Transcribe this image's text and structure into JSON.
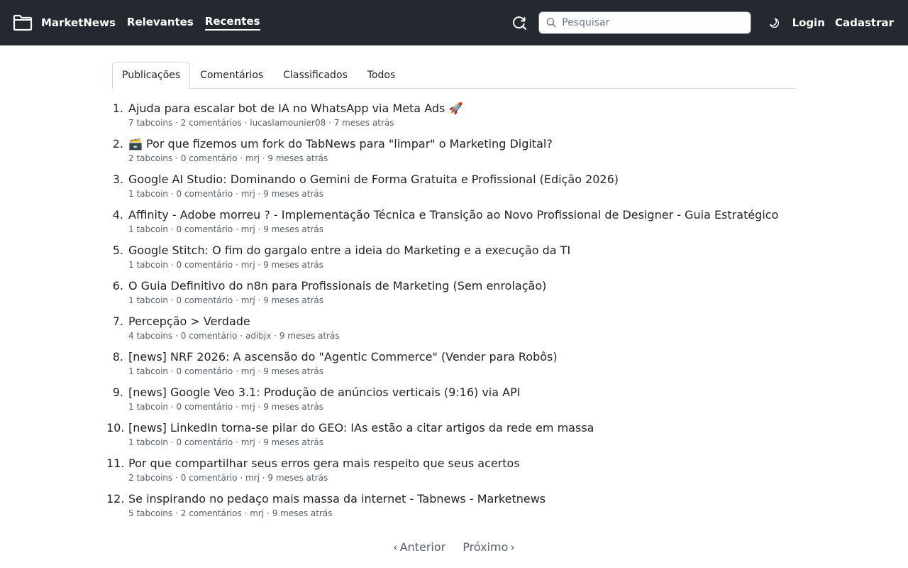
{
  "header": {
    "brand": "MarketNews",
    "nav": [
      {
        "label": "Relevantes"
      },
      {
        "label": "Recentes"
      }
    ],
    "search_placeholder": "Pesquisar",
    "login": "Login",
    "signup": "Cadastrar",
    "icons": [
      "folder-logo-icon",
      "refresh-search-icon",
      "search-icon",
      "moon-icon"
    ]
  },
  "tabs": [
    {
      "label": "Publicações"
    },
    {
      "label": "Comentários"
    },
    {
      "label": "Classificados"
    },
    {
      "label": "Todos"
    }
  ],
  "sep": "·",
  "posts": [
    {
      "n": "1.",
      "title": "Ajuda para escalar bot de IA no WhatsApp via Meta Ads 🚀",
      "tabcoins": "7 tabcoins",
      "comments": "2 comentários",
      "author": "lucaslamounier08",
      "time": "7 meses atrás"
    },
    {
      "n": "2.",
      "title": "🗃️ Por que fizemos um fork do TabNews para \"limpar\" o Marketing Digital?",
      "tabcoins": "2 tabcoins",
      "comments": "0 comentário",
      "author": "mrj",
      "time": "9 meses atrás"
    },
    {
      "n": "3.",
      "title": "Google AI Studio: Dominando o Gemini de Forma Gratuita e Profissional (Edição 2026)",
      "tabcoins": "1 tabcoin",
      "comments": "0 comentário",
      "author": "mrj",
      "time": "9 meses atrás"
    },
    {
      "n": "4.",
      "title": "Affinity - Adobe morreu ? - Implementação Técnica e Transição ao Novo Profissional de Designer - Guia Estratégico",
      "tabcoins": "1 tabcoin",
      "comments": "0 comentário",
      "author": "mrj",
      "time": "9 meses atrás"
    },
    {
      "n": "5.",
      "title": "Google Stitch: O fim do gargalo entre a ideia do Marketing e a execução da TI",
      "tabcoins": "1 tabcoin",
      "comments": "0 comentário",
      "author": "mrj",
      "time": "9 meses atrás"
    },
    {
      "n": "6.",
      "title": "O Guia Definitivo do n8n para Profissionais de Marketing (Sem enrolação)",
      "tabcoins": "1 tabcoin",
      "comments": "0 comentário",
      "author": "mrj",
      "time": "9 meses atrás"
    },
    {
      "n": "7.",
      "title": "Percepção > Verdade",
      "tabcoins": "4 tabcoins",
      "comments": "0 comentário",
      "author": "adibjx",
      "time": "9 meses atrás"
    },
    {
      "n": "8.",
      "title": "[news] NRF 2026: A ascensão do \"Agentic Commerce\" (Vender para Robôs)",
      "tabcoins": "1 tabcoin",
      "comments": "0 comentário",
      "author": "mrj",
      "time": "9 meses atrás"
    },
    {
      "n": "9.",
      "title": "[news] Google Veo 3.1: Produção de anúncios verticais (9:16) via API",
      "tabcoins": "1 tabcoin",
      "comments": "0 comentário",
      "author": "mrj",
      "time": "9 meses atrás"
    },
    {
      "n": "10.",
      "title": "[news] LinkedIn torna-se pilar do GEO: IAs estão a citar artigos da rede em massa",
      "tabcoins": "1 tabcoin",
      "comments": "0 comentário",
      "author": "mrj",
      "time": "9 meses atrás"
    },
    {
      "n": "11.",
      "title": "Por que compartilhar seus erros gera mais respeito que seus acertos",
      "tabcoins": "2 tabcoins",
      "comments": "0 comentário",
      "author": "mrj",
      "time": "9 meses atrás"
    },
    {
      "n": "12.",
      "title": "Se inspirando no pedaço mais massa da internet - Tabnews - Marketnews",
      "tabcoins": "5 tabcoins",
      "comments": "2 comentários",
      "author": "mrj",
      "time": "9 meses atrás"
    }
  ],
  "pagination": {
    "prev": "Anterior",
    "next": "Próximo"
  }
}
